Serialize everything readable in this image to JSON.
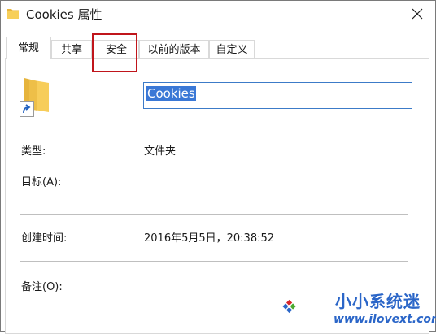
{
  "window": {
    "title": "Cookies 属性",
    "title_icon": "folder-icon",
    "close_icon": "close-icon"
  },
  "tabs": [
    {
      "label": "常规",
      "active": true
    },
    {
      "label": "共享",
      "active": false
    },
    {
      "label": "安全",
      "active": false,
      "highlighted": true
    },
    {
      "label": "以前的版本",
      "active": false
    },
    {
      "label": "自定义",
      "active": false
    }
  ],
  "general": {
    "name_value": "Cookies",
    "type_label": "类型:",
    "type_value": "文件夹",
    "target_label": "目标(A):",
    "created_label": "创建时间:",
    "created_value": "2016年5月5日，20:38:52",
    "comment_label": "备注(O):"
  },
  "watermark": {
    "site_name": "小小系统迷",
    "url": "www.ilovext.com"
  },
  "colors": {
    "highlight_red": "#c0151b",
    "selection_blue": "#3a78d6",
    "input_border": "#3c7bc8",
    "folder_yellow": "#f5c94e"
  }
}
